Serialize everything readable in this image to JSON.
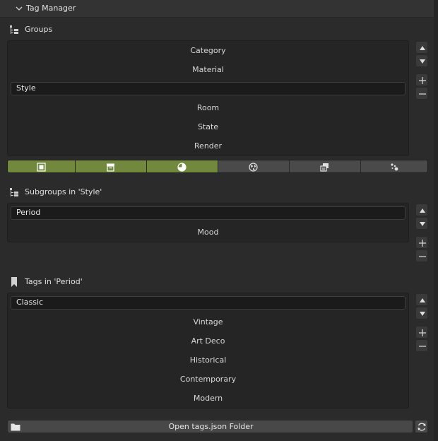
{
  "panel": {
    "title": "Tag Manager"
  },
  "groups": {
    "heading": "Groups",
    "items": [
      "Category",
      "Material",
      "Style",
      "Room",
      "State",
      "Render"
    ],
    "selected_index": 2
  },
  "filter_bar": {
    "buttons": [
      {
        "icon": "object-icon",
        "active": true
      },
      {
        "icon": "archive-icon",
        "active": true
      },
      {
        "icon": "shading-icon",
        "active": true
      },
      {
        "icon": "world-icon",
        "active": false
      },
      {
        "icon": "copy-stack-icon",
        "active": false
      },
      {
        "icon": "particles-icon",
        "active": false
      }
    ],
    "active_color": "#71883d"
  },
  "subgroups": {
    "heading": "Subgroups in 'Style'",
    "items": [
      "Period",
      "Mood"
    ],
    "selected_index": 0
  },
  "tags": {
    "heading": "Tags in 'Period'",
    "items": [
      "Classic",
      "Vintage",
      "Art Deco",
      "Historical",
      "Contemporary",
      "Modern"
    ],
    "selected_index": 0
  },
  "footer": {
    "open_button_label": "Open tags.json Folder",
    "folder_icon": "folder-icon",
    "refresh_icon": "refresh-icon"
  }
}
